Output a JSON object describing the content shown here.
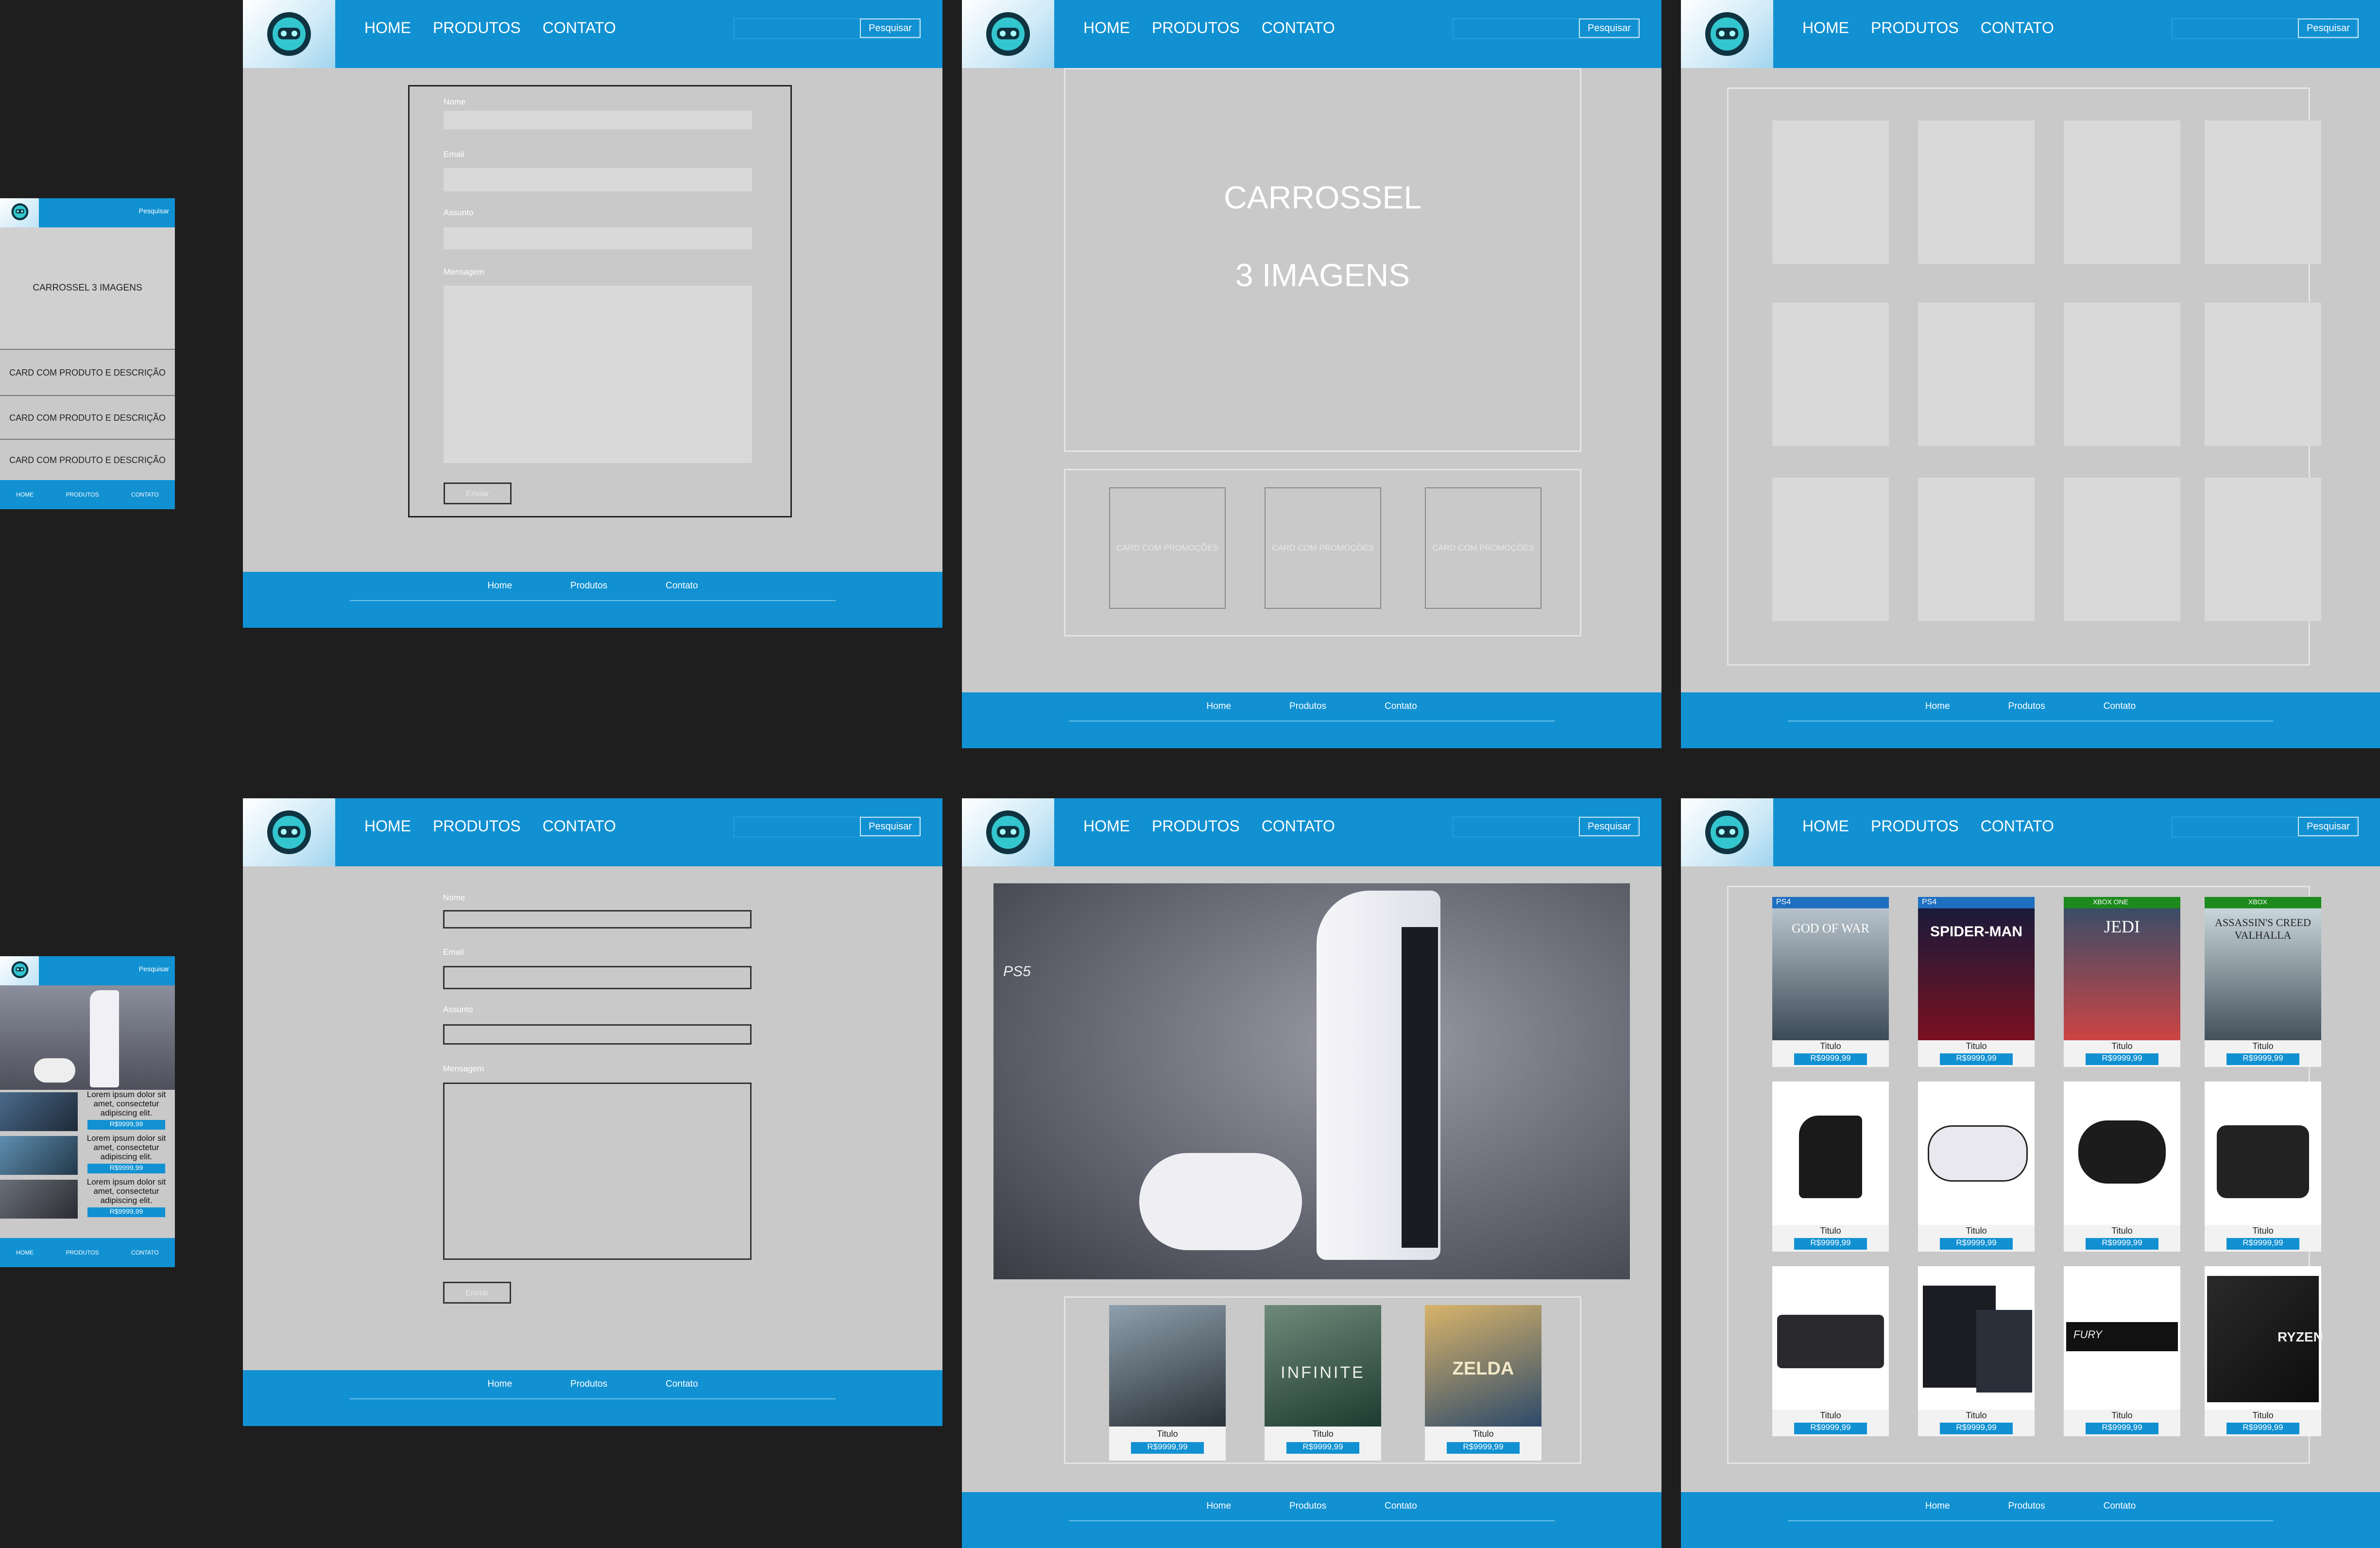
{
  "nav": {
    "home": "HOME",
    "products": "PRODUTOS",
    "contact": "CONTATO",
    "search": "Pesquisar"
  },
  "footer": {
    "home": "Home",
    "products": "Produtos",
    "contact": "Contato"
  },
  "mobile": {
    "search": "Pesquisar",
    "carousel": "CARROSSEL 3 IMAGENS",
    "card": "CARD COM PRODUTO E DESCRIÇÃO",
    "foot": {
      "home": "HOME",
      "products": "PRODUTOS",
      "contact": "CONTATO"
    },
    "lorem": "Lorem ipsum dolor sit amet, consectetur adipiscing elit.",
    "price": "R$9999,99"
  },
  "form": {
    "name": "Nome",
    "email": "Email",
    "subject": "Assunto",
    "message": "Mensagem",
    "submit": "Enviar"
  },
  "home": {
    "carousel_line1": "CARROSSEL",
    "carousel_line2": "3 IMAGENS",
    "promo": "CARD COM PROMOÇÕES",
    "ps5_label": "PS5"
  },
  "products": {
    "title": "Titulo",
    "price": "R$9999,99",
    "row1_names": [
      "GOD OF WAR",
      "SPIDER-MAN",
      "JEDI",
      "ASSASSIN'S CREED VALHALLA"
    ],
    "row1_platforms": [
      "PS4",
      "PS4",
      "XBOX ONE",
      "XBOX"
    ],
    "game_covers": [
      "INFINITE",
      "ZELDA"
    ],
    "ryzen": "RYZEN",
    "fury": "FURY"
  },
  "colors": {
    "brand": "#1191d2",
    "panel": "#c9c9c9",
    "placeholder": "#d9d9d9",
    "background": "#1e1e1e"
  }
}
